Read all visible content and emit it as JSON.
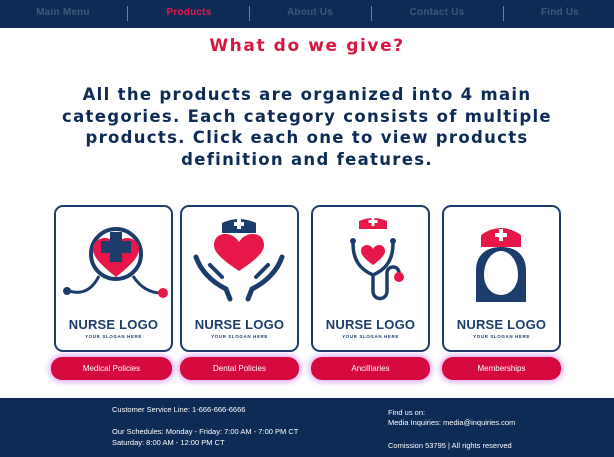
{
  "nav": {
    "items": [
      {
        "label": "Main Menu",
        "active": false
      },
      {
        "label": "Products",
        "active": true
      },
      {
        "label": "About Us",
        "active": false
      },
      {
        "label": "Contact Us",
        "active": false
      },
      {
        "label": "Find Us",
        "active": false
      }
    ]
  },
  "main": {
    "heading": "What do we give?",
    "intro": "All the products are organized into 4 main categories. Each category consists of multiple products. Click each one to view products definition and features."
  },
  "logos": [
    {
      "title": "NURSE LOGO",
      "subtitle": "YOUR SLOGAN HERE",
      "icon": "heart-cross-stethoscope-icon"
    },
    {
      "title": "NURSE LOGO",
      "subtitle": "YOUR SLOGAN HERE",
      "icon": "hands-heart-cap-icon"
    },
    {
      "title": "NURSE LOGO",
      "subtitle": "YOUR SLOGAN HERE",
      "icon": "cap-stethoscope-heart-icon"
    },
    {
      "title": "NURSE LOGO",
      "subtitle": "YOUR SLOGAN HERE",
      "icon": "nurse-avatar-icon"
    }
  ],
  "categories": [
    {
      "label": "Medical Policies"
    },
    {
      "label": "Dental Policies"
    },
    {
      "label": "Ancilliaries"
    },
    {
      "label": "Memberships"
    }
  ],
  "footer": {
    "service_line": "Customer Service Line: 1-666-666-6666",
    "schedule_weekdays": "Our Schedules: Monday - Friday: 7:00 AM - 7:00 PM CT",
    "schedule_saturday": "Saturday: 8:00 AM - 12:00 PM CT",
    "find_us": "Find us on:",
    "media": "Media Inquiries: media@inquiries.com",
    "commission": "Comission 53795 | All rights reserved"
  },
  "colors": {
    "navy": "#0d2b55",
    "accent": "#d6093f",
    "heading": "#d6173f"
  }
}
